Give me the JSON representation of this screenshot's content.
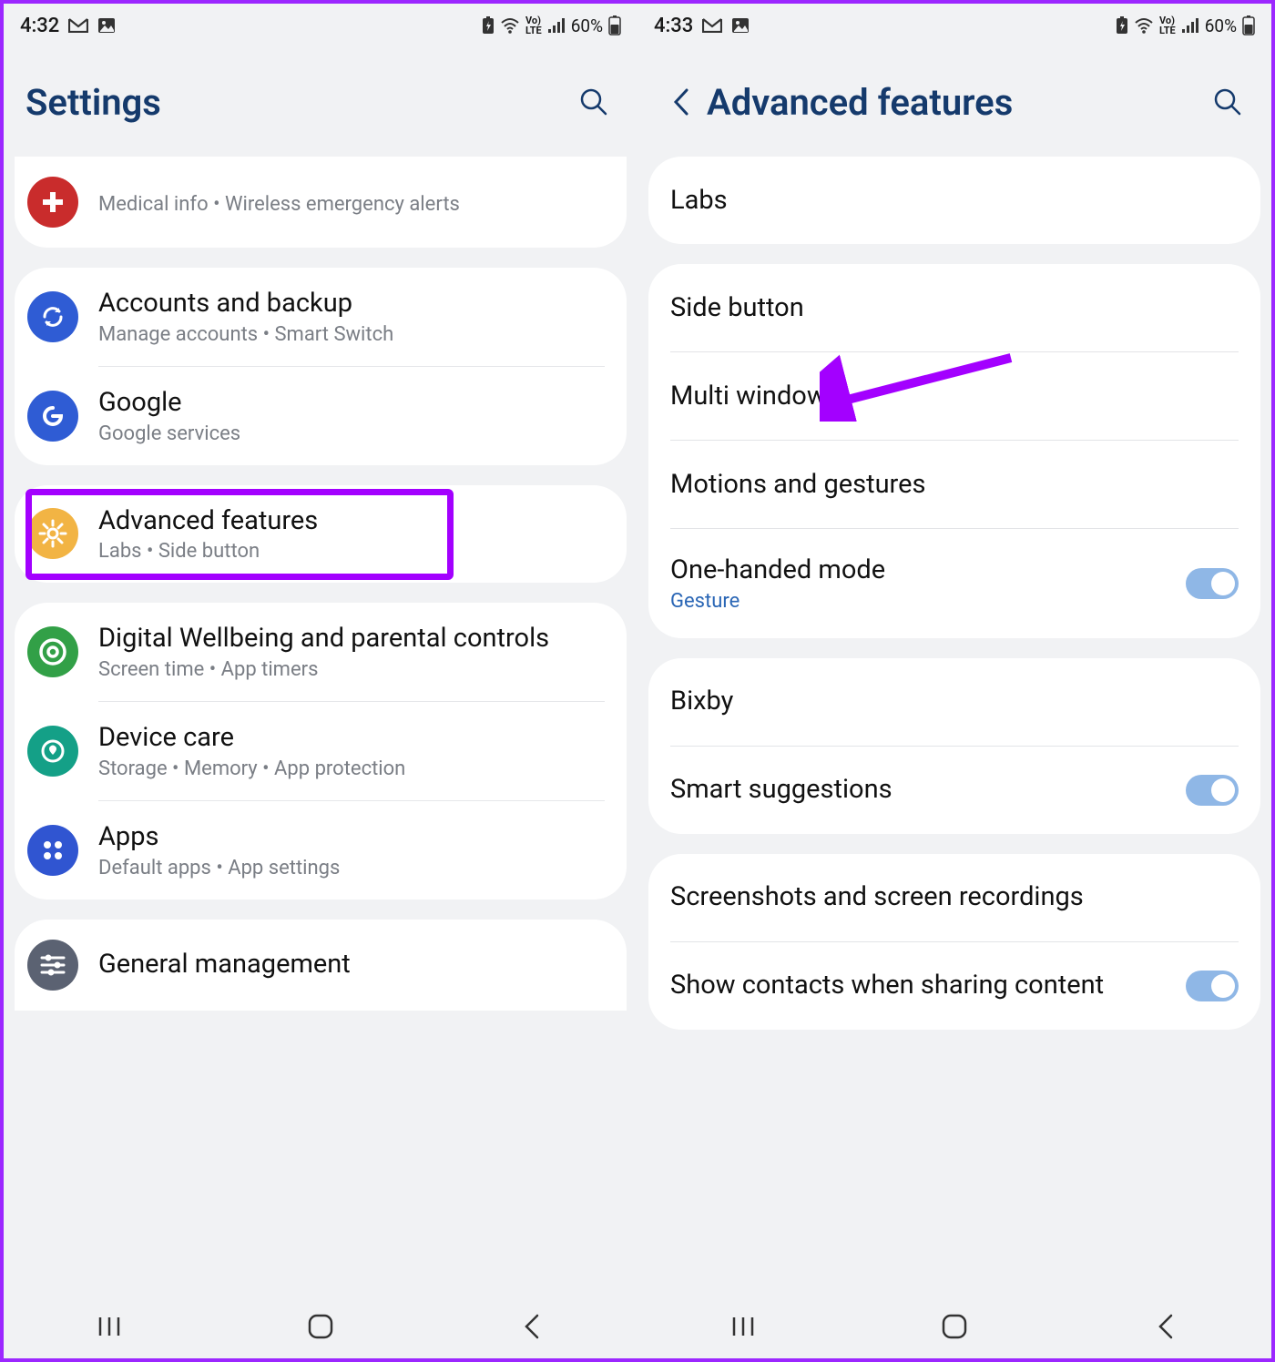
{
  "left": {
    "status": {
      "time": "4:32",
      "battery": "60%"
    },
    "header": {
      "title": "Settings"
    },
    "groups": [
      {
        "partial": "top",
        "items": [
          {
            "icon": "medical",
            "color": "#c92c2c",
            "title": "",
            "sub": "Medical info  •  Wireless emergency alerts"
          }
        ]
      },
      {
        "items": [
          {
            "icon": "sync",
            "color": "#2f5cd4",
            "title": "Accounts and backup",
            "sub": "Manage accounts  •  Smart Switch"
          },
          {
            "icon": "google",
            "color": "#2f5cd4",
            "title": "Google",
            "sub": "Google services"
          }
        ]
      },
      {
        "highlight": true,
        "items": [
          {
            "icon": "gear",
            "color": "#f2b444",
            "title": "Advanced features",
            "sub": "Labs  •  Side button"
          }
        ]
      },
      {
        "items": [
          {
            "icon": "wellbeing",
            "color": "#32a047",
            "title": "Digital Wellbeing and parental controls",
            "sub": "Screen time  •  App timers"
          },
          {
            "icon": "devicecare",
            "color": "#14a087",
            "title": "Device care",
            "sub": "Storage  •  Memory  •  App protection"
          },
          {
            "icon": "apps",
            "color": "#3055d1",
            "title": "Apps",
            "sub": "Default apps  •  App settings"
          }
        ]
      },
      {
        "partial": "bottom",
        "items": [
          {
            "icon": "sliders",
            "color": "#5b6272",
            "title": "General management",
            "sub": ""
          }
        ]
      }
    ]
  },
  "right": {
    "status": {
      "time": "4:33",
      "battery": "60%"
    },
    "header": {
      "title": "Advanced features"
    },
    "groups": [
      {
        "items": [
          {
            "title": "Labs"
          }
        ]
      },
      {
        "arrow_target": 0,
        "items": [
          {
            "title": "Side button"
          },
          {
            "title": "Multi window"
          },
          {
            "title": "Motions and gestures"
          },
          {
            "title": "One-handed mode",
            "sub": "Gesture",
            "subBlue": true,
            "toggle": true
          }
        ]
      },
      {
        "items": [
          {
            "title": "Bixby"
          },
          {
            "title": "Smart suggestions",
            "toggle": true
          }
        ]
      },
      {
        "items": [
          {
            "title": "Screenshots and screen recordings"
          },
          {
            "title": "Show contacts when sharing content",
            "toggle": true
          }
        ]
      }
    ]
  }
}
